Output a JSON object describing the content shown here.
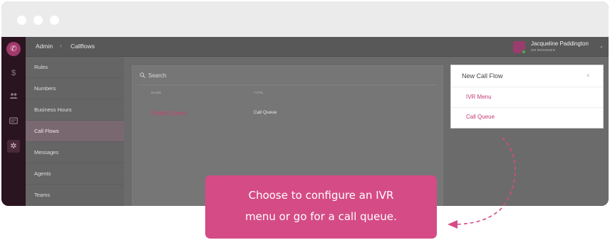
{
  "window": {
    "controls": [
      "close",
      "minimize",
      "maximize"
    ]
  },
  "rail": {
    "logo_icon": "phone-icon",
    "icons": [
      "dollar-icon",
      "people-icon",
      "card-icon",
      "gear-icon"
    ],
    "active_icon": "gear-icon"
  },
  "topbar": {
    "breadcrumb": [
      "Admin",
      "Callflows"
    ],
    "separator": "›",
    "user": {
      "name": "Jacqueline Paddington",
      "status": "ON BROWSER"
    },
    "caret": "⌄"
  },
  "sidebar": {
    "items": [
      {
        "label": "Rules"
      },
      {
        "label": "Numbers"
      },
      {
        "label": "Business Hours"
      },
      {
        "label": "Call Flows",
        "active": true
      },
      {
        "label": "Messages"
      },
      {
        "label": "Agents"
      },
      {
        "label": "Teams"
      }
    ]
  },
  "list": {
    "search_placeholder": "Search",
    "columns": [
      "NAME",
      "TYPE"
    ],
    "rows": [
      {
        "name": "Global Queue",
        "type": "Call Queue"
      }
    ]
  },
  "panel": {
    "title": "New Call Flow",
    "close": "×",
    "options": [
      "IVR Menu",
      "Call Queue"
    ]
  },
  "callout": {
    "lines": [
      "Choose to configure an IVR",
      "menu or go for a call queue."
    ]
  },
  "colors": {
    "accent": "#d54b86",
    "link": "#c23a74",
    "rail": "#2a1420"
  }
}
